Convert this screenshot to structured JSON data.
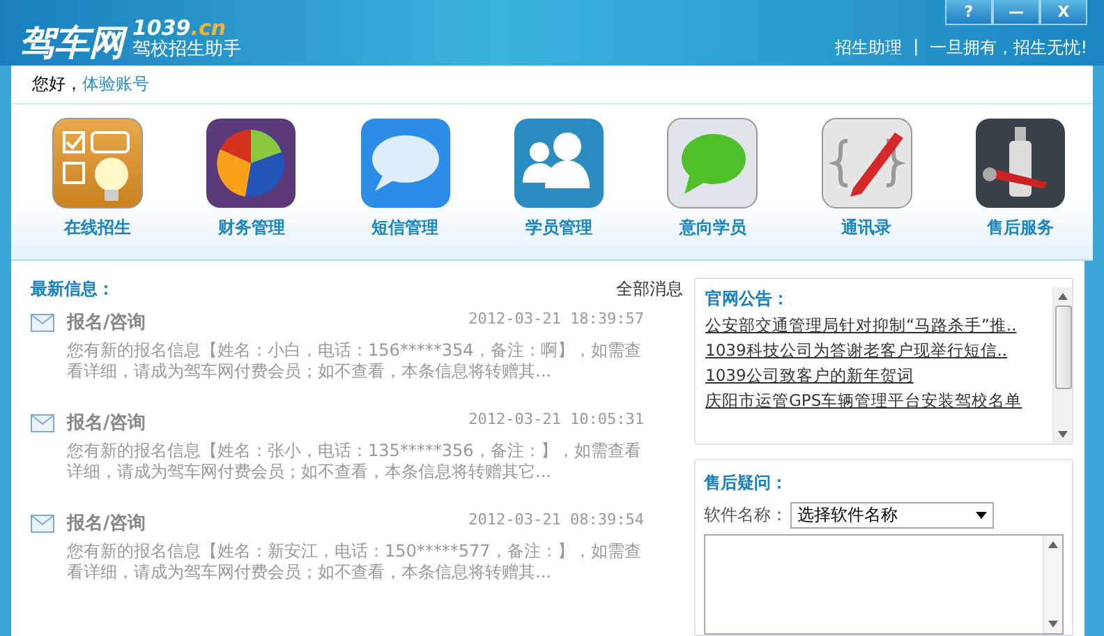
{
  "window": {
    "logo": "驾车网",
    "brand_number": "1039",
    "brand_domain": ".cn",
    "title": "驾校招生助手",
    "buttons": [
      "?",
      "—",
      "X"
    ],
    "slogan_left": "招生助理",
    "slogan_separator": "|",
    "slogan_right": "一旦拥有，招生无忧!"
  },
  "greeting": {
    "label": "您好，",
    "account": "体验账号"
  },
  "toolbar": [
    {
      "kind": "enroll",
      "label": "在线招生"
    },
    {
      "kind": "finance",
      "label": "财务管理"
    },
    {
      "kind": "sms",
      "label": "短信管理"
    },
    {
      "kind": "students",
      "label": "学员管理"
    },
    {
      "kind": "prospects",
      "label": "意向学员"
    },
    {
      "kind": "contacts",
      "label": "通讯录"
    },
    {
      "kind": "service",
      "label": "售后服务"
    }
  ],
  "messages": {
    "title": "最新信息：",
    "all_link": "全部消息",
    "items": [
      {
        "subject": "报名/咨询",
        "time": "2012-03-21 18:39:57",
        "body": "您有新的报名信息【姓名：小白，电话：156*****354，备注：啊】，如需查看详细，请成为驾车网付费会员；如不查看，本条信息将转赠其..."
      },
      {
        "subject": "报名/咨询",
        "time": "2012-03-21 10:05:31",
        "body": "您有新的报名信息【姓名：张小，电话：135*****356，备注：】，如需查看详细，请成为驾车网付费会员；如不查看，本条信息将转赠其它..."
      },
      {
        "subject": "报名/咨询",
        "time": "2012-03-21 08:39:54",
        "body": "您有新的报名信息【姓名：新安江，电话：150*****577，备注：】，如需查看详细，请成为驾车网付费会员；如不查看，本条信息将转赠其..."
      }
    ]
  },
  "announcements": {
    "title": "官网公告：",
    "items": [
      "公安部交通管理局针对抑制“马路杀手”推..",
      "1039科技公司为答谢老客户现举行短信..",
      "1039公司致客户的新年贺词",
      "庆阳市运管GPS车辆管理平台安装驾校名单"
    ]
  },
  "support": {
    "title": "售后疑问：",
    "software_label": "软件名称：",
    "software_select": "选择软件名称"
  }
}
